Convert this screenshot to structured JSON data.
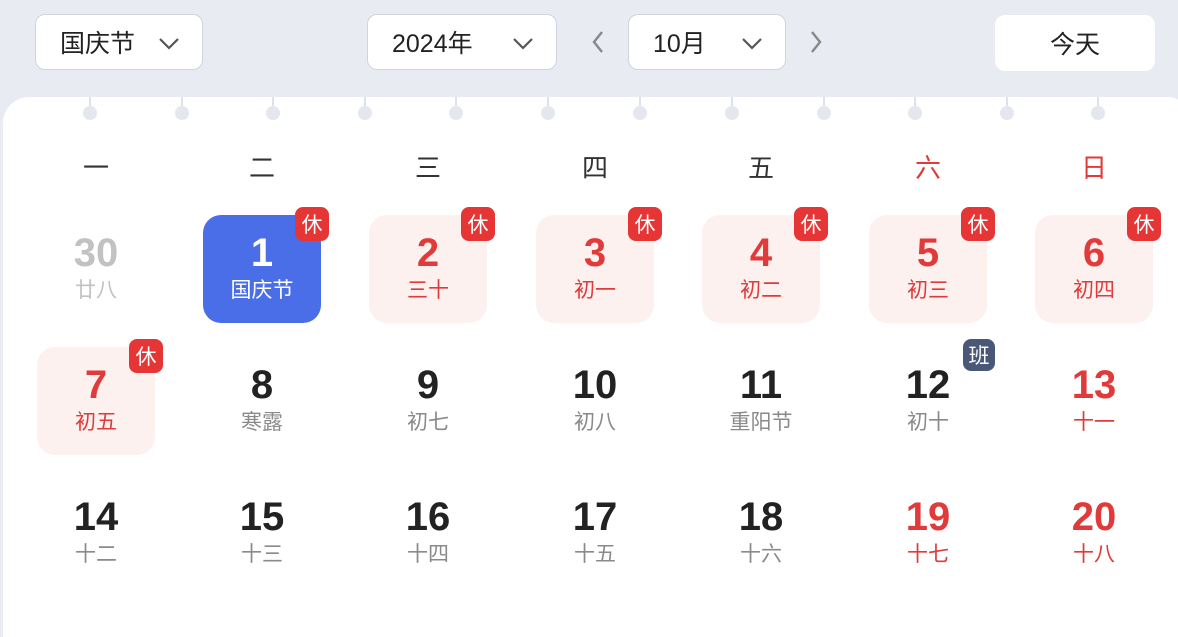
{
  "toolbar": {
    "holiday_select": "国庆节",
    "year_select": "2024年",
    "month_select": "10月",
    "today_label": "今天"
  },
  "weekdays": [
    "一",
    "二",
    "三",
    "四",
    "五",
    "六",
    "日"
  ],
  "weeks": [
    [
      {
        "day": "30",
        "lunar": "廿八",
        "state": "other-month"
      },
      {
        "day": "1",
        "lunar": "国庆节",
        "state": "selected",
        "badge": "休"
      },
      {
        "day": "2",
        "lunar": "三十",
        "state": "holiday",
        "badge": "休"
      },
      {
        "day": "3",
        "lunar": "初一",
        "state": "holiday",
        "badge": "休"
      },
      {
        "day": "4",
        "lunar": "初二",
        "state": "holiday",
        "badge": "休"
      },
      {
        "day": "5",
        "lunar": "初三",
        "state": "holiday",
        "badge": "休"
      },
      {
        "day": "6",
        "lunar": "初四",
        "state": "holiday",
        "badge": "休"
      }
    ],
    [
      {
        "day": "7",
        "lunar": "初五",
        "state": "holiday",
        "badge": "休"
      },
      {
        "day": "8",
        "lunar": "寒露",
        "state": "normal"
      },
      {
        "day": "9",
        "lunar": "初七",
        "state": "normal"
      },
      {
        "day": "10",
        "lunar": "初八",
        "state": "normal"
      },
      {
        "day": "11",
        "lunar": "重阳节",
        "state": "normal"
      },
      {
        "day": "12",
        "lunar": "初十",
        "state": "workday",
        "badge": "班"
      },
      {
        "day": "13",
        "lunar": "十一",
        "state": "weekend"
      }
    ],
    [
      {
        "day": "14",
        "lunar": "十二",
        "state": "normal"
      },
      {
        "day": "15",
        "lunar": "十三",
        "state": "normal"
      },
      {
        "day": "16",
        "lunar": "十四",
        "state": "normal"
      },
      {
        "day": "17",
        "lunar": "十五",
        "state": "normal"
      },
      {
        "day": "18",
        "lunar": "十六",
        "state": "normal"
      },
      {
        "day": "19",
        "lunar": "十七",
        "state": "weekend"
      },
      {
        "day": "20",
        "lunar": "十八",
        "state": "weekend"
      }
    ]
  ],
  "colors": {
    "selected": "#4a6ee8",
    "holiday_bg": "#fdf1f0",
    "red": "#e03a3a",
    "badge_rest": "#e53535",
    "badge_work": "#4a5776"
  }
}
